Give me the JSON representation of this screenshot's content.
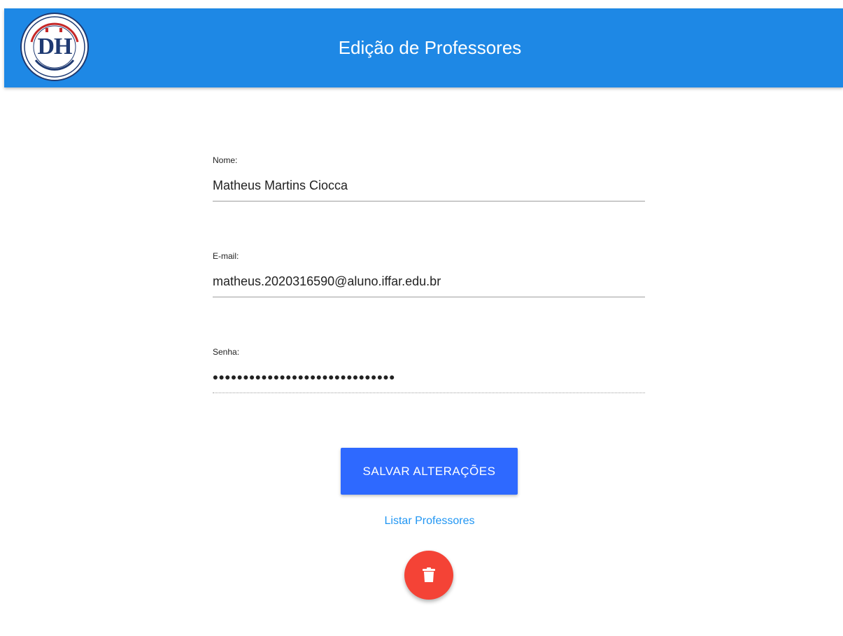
{
  "header": {
    "title": "Edição de Professores",
    "bg_color": "#1e88e5",
    "logo_icon": "school-logo-dh",
    "logo_letters": "DH"
  },
  "form": {
    "fields": [
      {
        "label": "Nome:",
        "value": "Matheus Martins Ciocca",
        "type": "text"
      },
      {
        "label": "E-mail:",
        "value": "matheus.2020316590@aluno.iffar.edu.br",
        "type": "text"
      },
      {
        "label": "Senha:",
        "value": "••••••••••••••••••••••••••••••",
        "type": "password"
      }
    ]
  },
  "actions": {
    "save_label": "SALVAR ALTERAÇÕES",
    "save_color": "#2e69ff",
    "list_link_label": "Listar Professores",
    "link_color": "#2196f3",
    "delete_icon": "trash-icon",
    "delete_color": "#f44336"
  }
}
